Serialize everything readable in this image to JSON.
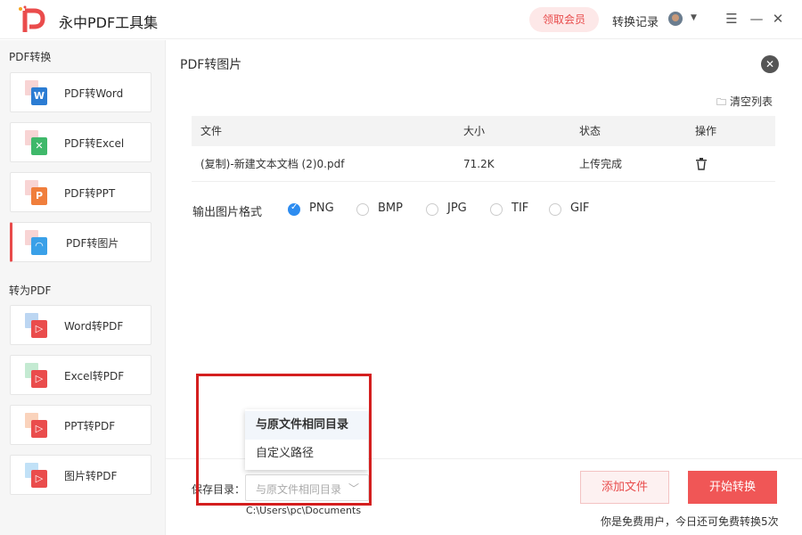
{
  "app": {
    "title": "永中PDF工具集",
    "vip_label": "领取会员",
    "history_label": "转换记录"
  },
  "window": {
    "menu": "☰",
    "minimize": "—",
    "close": "✕"
  },
  "colors": {
    "accent": "#e84b4b",
    "radio_checked": "#2d8cf0",
    "highlight_border": "#d41f1f",
    "word_blue": "#2b7cd3",
    "excel_green": "#3fb86a",
    "ppt_orange": "#f07e3c",
    "image_blue": "#3aa0e8",
    "to_pdf_red": "#ea4c4c"
  },
  "sidebar": {
    "section_from_pdf": "PDF转换",
    "from_pdf_items": [
      {
        "label": "PDF转Word",
        "icon": "word-file-icon",
        "glyph": "W"
      },
      {
        "label": "PDF转Excel",
        "icon": "excel-file-icon",
        "glyph": "✕"
      },
      {
        "label": "PDF转PPT",
        "icon": "ppt-file-icon",
        "glyph": "P"
      },
      {
        "label": "PDF转图片",
        "icon": "image-file-icon",
        "glyph": "◠",
        "active": true
      }
    ],
    "section_to_pdf": "转为PDF",
    "to_pdf_items": [
      {
        "label": "Word转PDF",
        "icon": "word-to-pdf-icon",
        "glyph": "▷"
      },
      {
        "label": "Excel转PDF",
        "icon": "excel-to-pdf-icon",
        "glyph": "▷"
      },
      {
        "label": "PPT转PDF",
        "icon": "ppt-to-pdf-icon",
        "glyph": "▷"
      },
      {
        "label": "图片转PDF",
        "icon": "image-to-pdf-icon",
        "glyph": "▷"
      }
    ]
  },
  "main": {
    "title": "PDF转图片",
    "close_glyph": "✕",
    "clear_list": "清空列表",
    "table": {
      "headers": {
        "file": "文件",
        "size": "大小",
        "status": "状态",
        "action": "操作"
      },
      "rows": [
        {
          "file": "(复制)-新建文本文档 (2)0.pdf",
          "size": "71.2K",
          "status": "上传完成",
          "action_icon": "trash-icon"
        }
      ]
    },
    "format_label": "输出图片格式",
    "formats": [
      {
        "label": "PNG",
        "checked": true
      },
      {
        "label": "BMP",
        "checked": false
      },
      {
        "label": "JPG",
        "checked": false
      },
      {
        "label": "TIF",
        "checked": false
      },
      {
        "label": "GIF",
        "checked": false
      }
    ]
  },
  "save": {
    "label": "保存目录：",
    "selected": "与原文件相同目录",
    "options": [
      "与原文件相同目录",
      "自定义路径"
    ],
    "path": "C:\\Users\\pc\\Documents"
  },
  "actions": {
    "add_file": "添加文件",
    "start": "开始转换"
  },
  "footer": {
    "free_note": "你是免费用户，今日还可免费转换5次"
  }
}
